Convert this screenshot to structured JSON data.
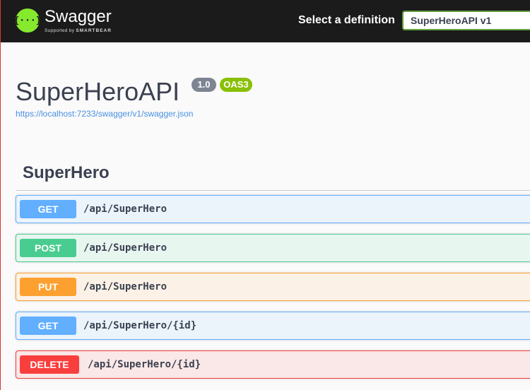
{
  "topbar": {
    "logo_text": "Swagger",
    "logo_sub_prefix": "Supported by",
    "logo_sub_brand": "SMARTBEAR",
    "select_label": "Select a definition",
    "selected_definition": "SuperHeroAPI v1"
  },
  "info": {
    "title": "SuperHeroAPI",
    "version": "1.0",
    "oas": "OAS3",
    "spec_url": "https://localhost:7233/swagger/v1/swagger.json"
  },
  "tag": {
    "name": "SuperHero"
  },
  "operations": [
    {
      "method": "GET",
      "path": "/api/SuperHero"
    },
    {
      "method": "POST",
      "path": "/api/SuperHero"
    },
    {
      "method": "PUT",
      "path": "/api/SuperHero"
    },
    {
      "method": "GET",
      "path": "/api/SuperHero/{id}"
    },
    {
      "method": "DELETE",
      "path": "/api/SuperHero/{id}"
    }
  ],
  "colors": {
    "topbar_bg": "#1b1b1b",
    "logo_green": "#85ea2d",
    "get": "#61affe",
    "post": "#49cc90",
    "put": "#fca130",
    "delete": "#f93e3e",
    "link": "#4990e2"
  },
  "icons": {
    "logo": "swagger-braces-icon"
  }
}
